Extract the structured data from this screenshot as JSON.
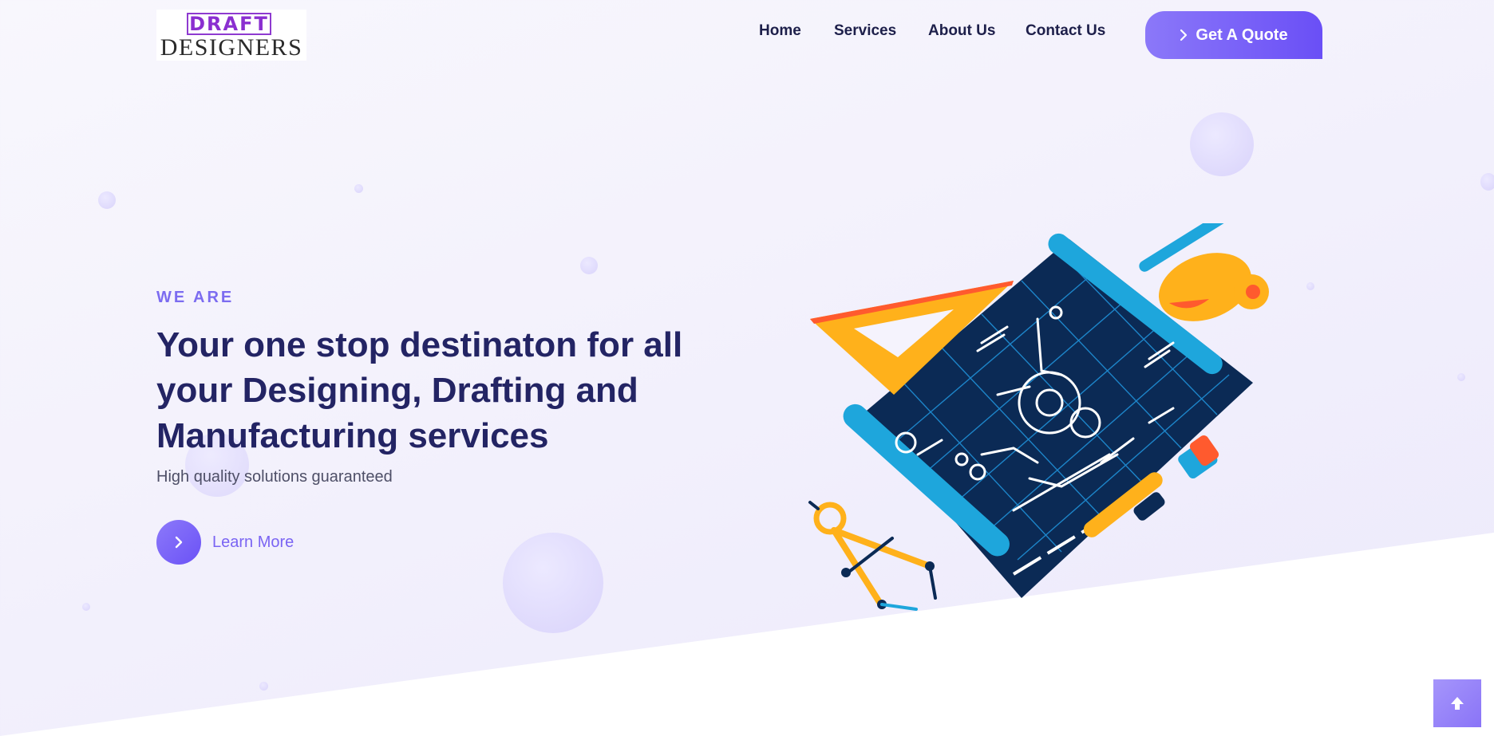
{
  "logo": {
    "box_text": "DRAFT",
    "word_text": "DESIGNERS"
  },
  "nav": {
    "items": [
      {
        "label": "Home"
      },
      {
        "label": "Services"
      },
      {
        "label": "About Us"
      },
      {
        "label": "Contact Us"
      }
    ],
    "quote_label": "Get A Quote"
  },
  "hero": {
    "eyebrow": "WE ARE",
    "title": "Your one stop destinaton for all your Designing, Drafting and Manufacturing services",
    "subtitle": "High quality solutions guaranteed",
    "cta_label": "Learn More"
  },
  "icons": {
    "quote": "chevron-right-icon",
    "learn_more": "chevron-right-icon",
    "scroll_top": "arrow-up-icon",
    "illustration": "blueprint-drafting-illustration"
  },
  "colors": {
    "accent": "#6a4ff6",
    "accent_light": "#8b78f9",
    "heading": "#232464",
    "text": "#4e4f67",
    "background": "#f3f1fc"
  }
}
